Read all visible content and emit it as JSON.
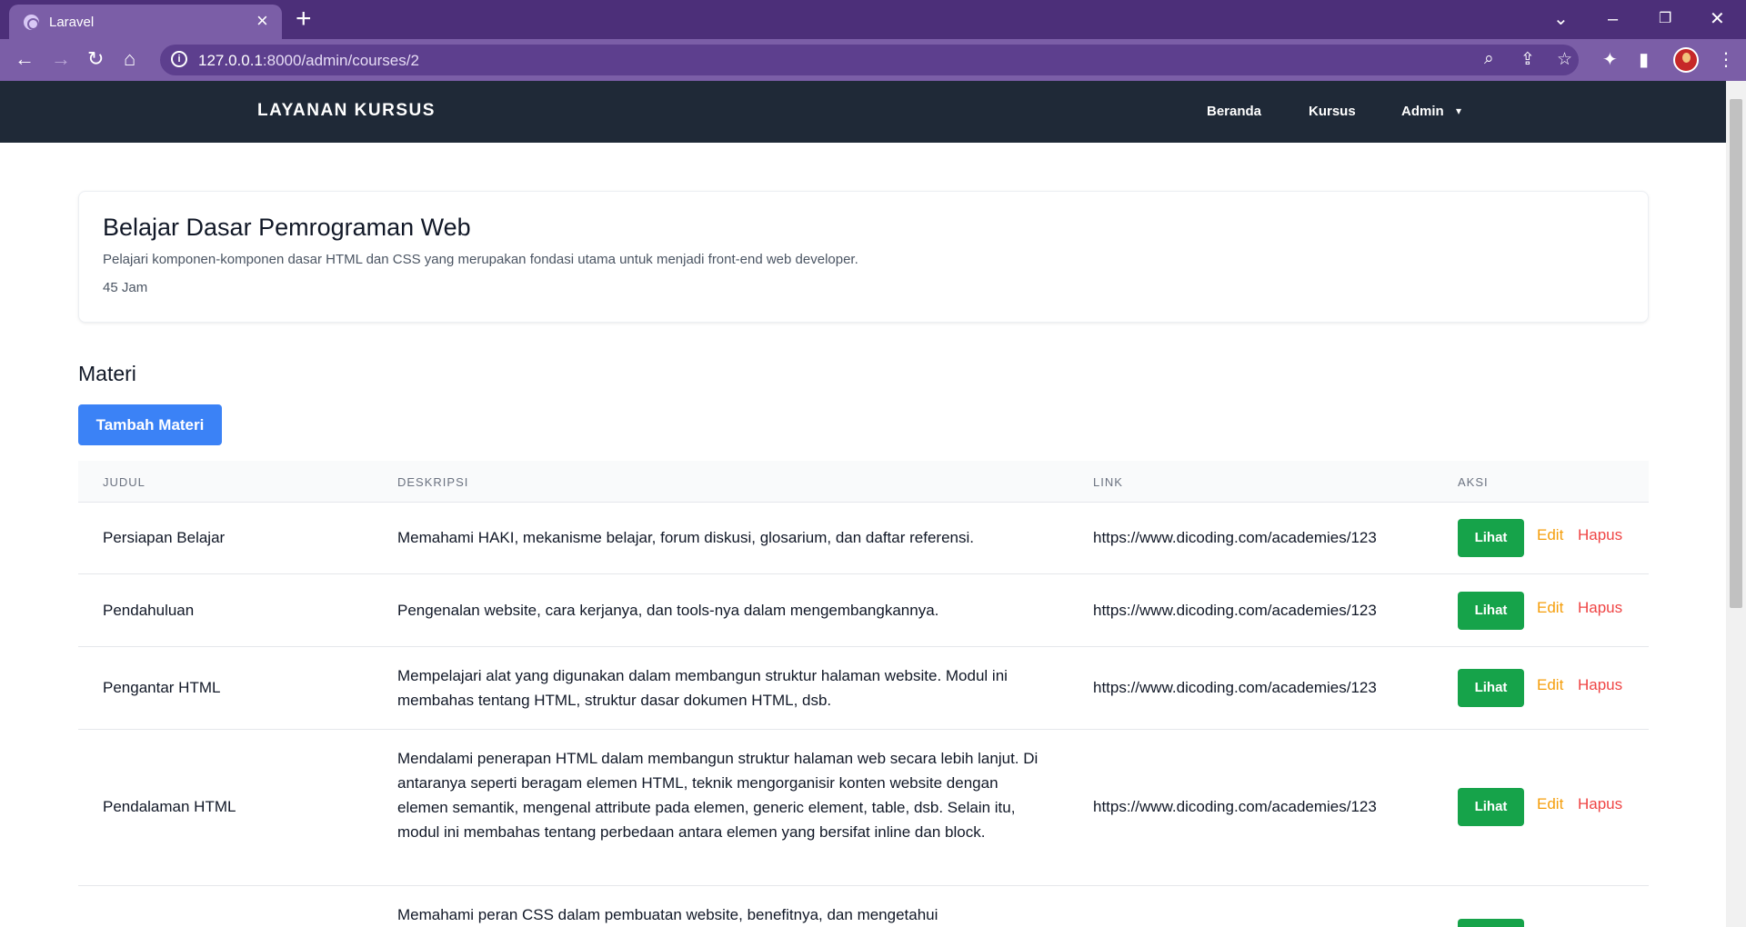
{
  "browser": {
    "tab_title": "Laravel",
    "url_host": "127.0.0.1",
    "url_path": ":8000/admin/courses/2"
  },
  "navbar": {
    "brand": "LAYANAN KURSUS",
    "links": [
      "Beranda",
      "Kursus",
      "Admin"
    ]
  },
  "course": {
    "title": "Belajar Dasar Pemrograman Web",
    "description": "Pelajari komponen-komponen dasar HTML dan CSS yang merupakan fondasi utama untuk menjadi front-end web developer.",
    "duration": "45 Jam"
  },
  "materi": {
    "heading": "Materi",
    "add_button": "Tambah Materi",
    "columns": [
      "JUDUL",
      "DESKRIPSI",
      "LINK",
      "AKSI"
    ],
    "actions": {
      "view": "Lihat",
      "edit": "Edit",
      "delete": "Hapus"
    },
    "rows": [
      {
        "title": "Persiapan Belajar",
        "description": "Memahami HAKI, mekanisme belajar, forum diskusi, glosarium, dan daftar referensi.",
        "link": "https://www.dicoding.com/academies/123"
      },
      {
        "title": "Pendahuluan",
        "description": "Pengenalan website, cara kerjanya, dan tools-nya dalam mengembangkannya.",
        "link": "https://www.dicoding.com/academies/123"
      },
      {
        "title": "Pengantar HTML",
        "description": "Mempelajari alat yang digunakan dalam membangun struktur halaman website. Modul ini membahas tentang HTML, struktur dasar dokumen HTML, dsb.",
        "link": "https://www.dicoding.com/academies/123"
      },
      {
        "title": "Pendalaman HTML",
        "description": "Mendalami penerapan HTML dalam membangun struktur halaman web secara lebih lanjut. Di antaranya seperti beragam elemen HTML, teknik mengorganisir konten website dengan elemen semantik, mengenal attribute pada elemen, generic element, table, dsb. Selain itu, modul ini membahas tentang perbedaan antara elemen yang bersifat inline dan block.",
        "link": "https://www.dicoding.com/academies/123"
      },
      {
        "title": "",
        "description": "Memahami peran CSS dalam pembuatan website, benefitnya, dan mengetahui",
        "link": ""
      }
    ]
  }
}
